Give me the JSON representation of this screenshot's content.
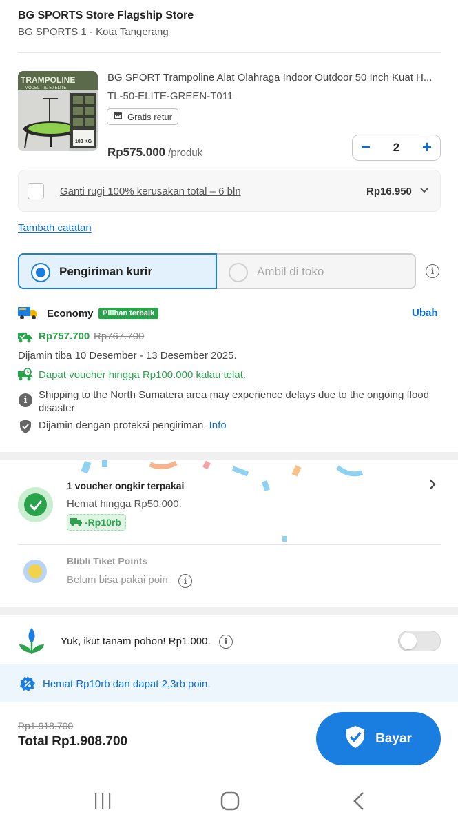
{
  "store": {
    "name": "BG SPORTS Store Flagship Store",
    "location": "BG SPORTS 1 - Kota Tangerang"
  },
  "product": {
    "title": "BG SPORT Trampoline Alat Olahraga Indoor Outdoor 50 Inch Kuat H...",
    "variant": "TL-50-ELITE-GREEN-T011",
    "return_badge": "Gratis retur",
    "price": "Rp575.000",
    "price_unit": "/produk",
    "quantity": "2",
    "minus": "−",
    "plus": "+",
    "thumb_brand": "TRAMPOLINE",
    "thumb_model": "MODEL · TL-50 ELITE",
    "thumb_capacity": "100 KG"
  },
  "protection": {
    "label": "Ganti rugi 100% kerusakan total – 6 bln",
    "amount": "Rp16.950"
  },
  "add_note": "Tambah catatan",
  "shipping_tabs": {
    "courier": "Pengiriman kurir",
    "pickup": "Ambil di toko"
  },
  "courier": {
    "name": "Economy",
    "badge": "Pilihan terbaik",
    "change": "Ubah",
    "price": "Rp757.700",
    "old_price": "Rp767.700",
    "eta": "Dijamin tiba 10 Desember - 13 Desember 2025.",
    "late_voucher": "Dapat voucher hingga Rp100.000 kalau telat.",
    "flood_notice": "Shipping to the North Sumatera area may experience delays due to the ongoing flood disaster",
    "guarantee": "Dijamin dengan proteksi pengiriman.",
    "guarantee_link": "Info"
  },
  "voucher": {
    "title": "1 voucher ongkir terpakai",
    "subtitle": "Hemat hingga Rp50.000.",
    "chip": "-Rp10rb"
  },
  "points": {
    "title": "Blibli Tiket Points",
    "subtitle": "Belum bisa pakai poin"
  },
  "tree": {
    "label": "Yuk, ikut tanam pohon! Rp1.000."
  },
  "savings": "Hemat Rp10rb dan dapat 2,3rb poin.",
  "footer": {
    "old_total": "Rp1.918.700",
    "total": "Total Rp1.908.700",
    "pay": "Bayar"
  },
  "colors": {
    "accent": "#1a7de0",
    "green": "#2ba24c"
  }
}
